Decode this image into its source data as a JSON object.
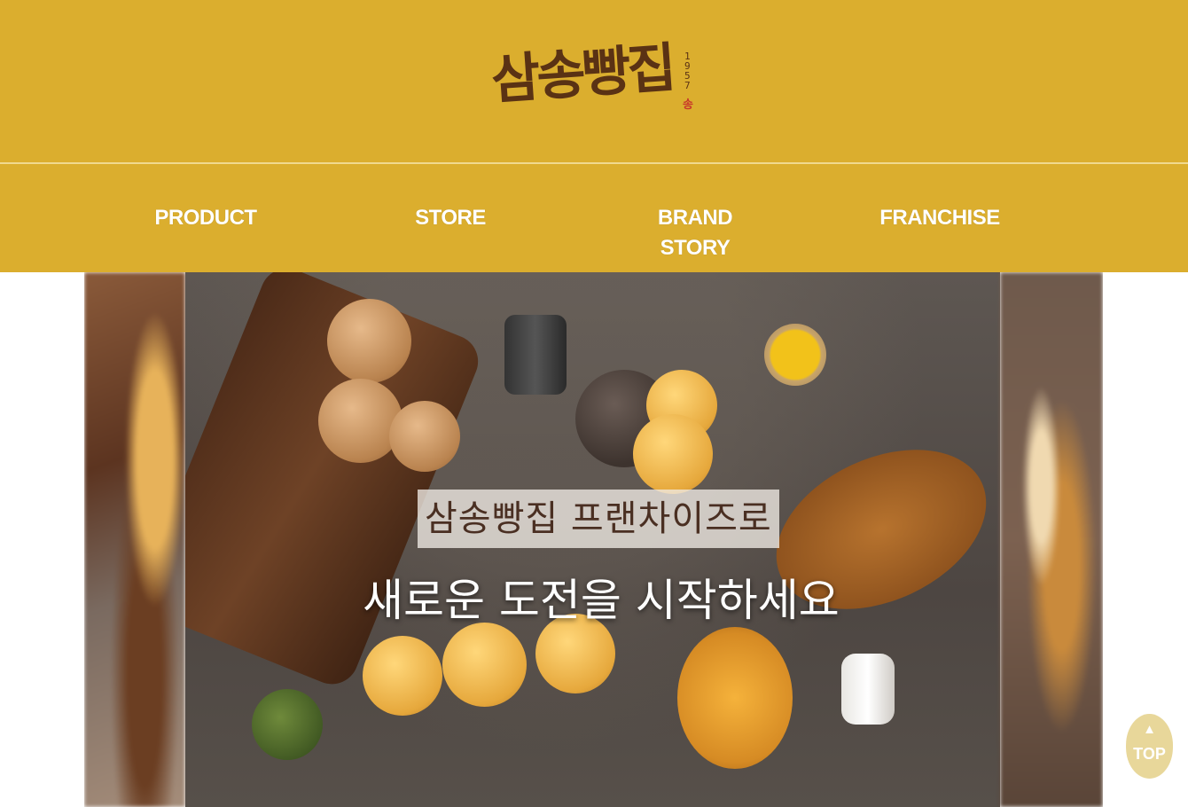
{
  "header": {
    "logo_text": "삼송빵집",
    "logo_year": "1957",
    "logo_seal": "송"
  },
  "nav": {
    "items": [
      {
        "label": "PRODUCT"
      },
      {
        "label": "STORE"
      },
      {
        "label": "BRAND STORY"
      },
      {
        "label": "FRANCHISE"
      }
    ]
  },
  "banner": {
    "headline_1": "삼송빵집 프랜차이즈로",
    "headline_2": "새로운 도전을 시작하세요"
  },
  "top_button": {
    "arrow": "▲",
    "label": "TOP"
  },
  "colors": {
    "header_bg": "#DBAE2E",
    "logo_brown": "#5a3214",
    "top_button_bg": "#e8d79a"
  }
}
